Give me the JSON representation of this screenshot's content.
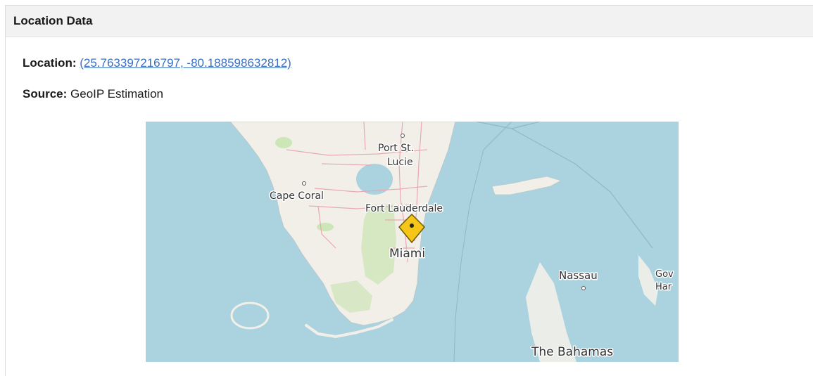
{
  "panel": {
    "title": "Location Data"
  },
  "location": {
    "label": "Location:",
    "value": "(25.763397216797, -80.188598632812)"
  },
  "source": {
    "label": "Source:",
    "value": "GeoIP Estimation"
  },
  "map": {
    "labels": {
      "port_st_lucie_1": "Port St.",
      "port_st_lucie_2": "Lucie",
      "cape_coral": "Cape Coral",
      "fort_lauderdale": "Fort Lauderdale",
      "miami": "Miami",
      "nassau": "Nassau",
      "gov_1": "Gov",
      "gov_2": "Har",
      "bahamas": "The Bahamas"
    },
    "colors": {
      "water": "#aad3df",
      "land": "#f2efe9",
      "park": "#cde6b8",
      "roads": "#e8a8b4",
      "marker": "#f5c518"
    }
  }
}
